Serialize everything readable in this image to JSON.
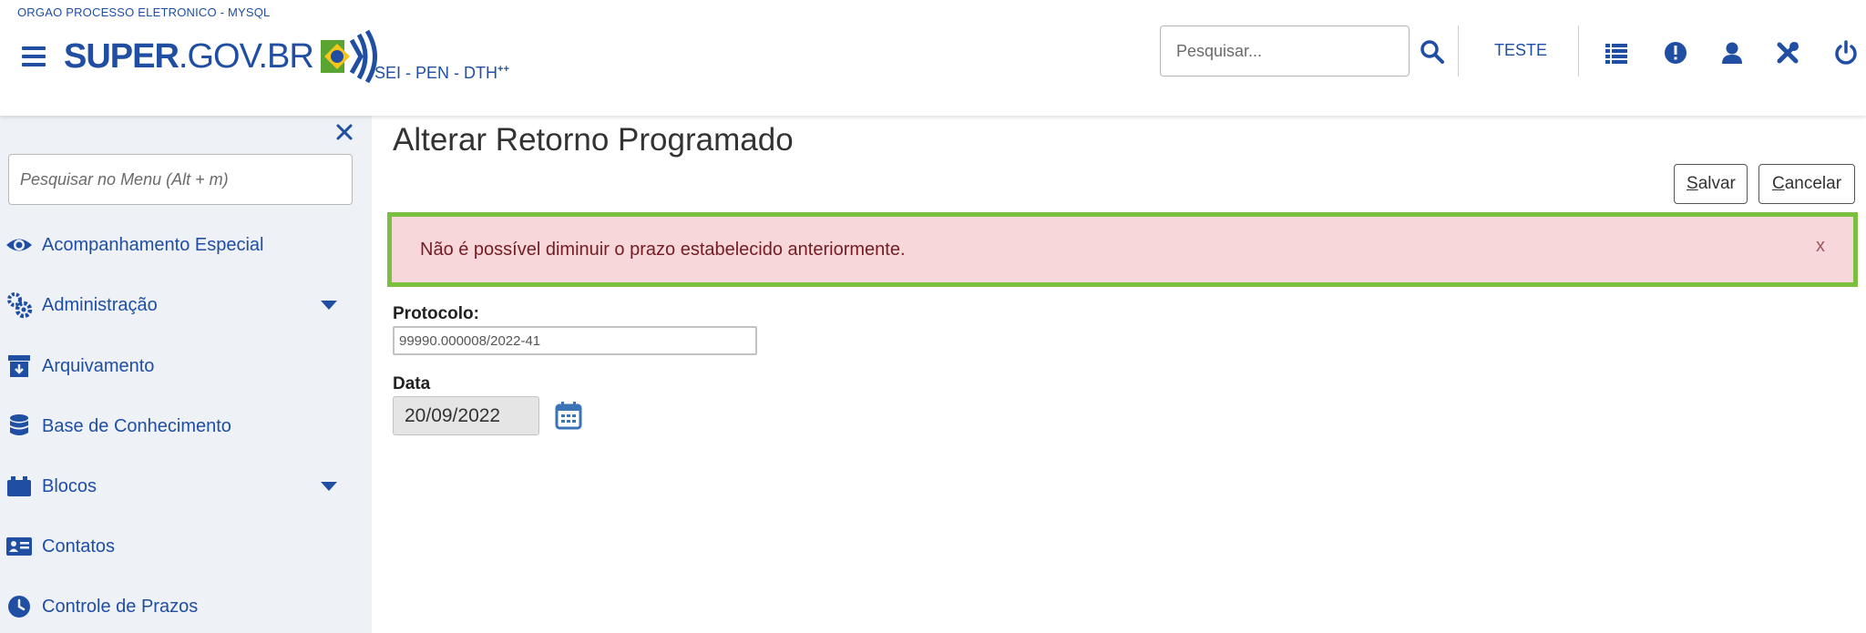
{
  "header": {
    "org_name": "ORGAO PROCESSO ELETRONICO - MYSQL",
    "logo_bold": "SUPER",
    "logo_thin": ".GOV.BR",
    "subtitle": "SEI - PEN - DTH",
    "subtitle_sup": "++",
    "search_placeholder": "Pesquisar...",
    "unit": "TESTE",
    "icons": [
      "menu-icon",
      "search-icon",
      "list-icon",
      "info-icon",
      "user-icon",
      "tools-icon",
      "power-icon"
    ]
  },
  "sidebar": {
    "menu_search_placeholder": "Pesquisar no Menu (Alt + m)",
    "items": [
      {
        "label": "Acompanhamento Especial",
        "icon": "eye-icon",
        "expandable": false
      },
      {
        "label": "Administração",
        "icon": "gears-icon",
        "expandable": true
      },
      {
        "label": "Arquivamento",
        "icon": "archive-icon",
        "expandable": false
      },
      {
        "label": "Base de Conhecimento",
        "icon": "database-icon",
        "expandable": false
      },
      {
        "label": "Blocos",
        "icon": "blocks-icon",
        "expandable": true
      },
      {
        "label": "Contatos",
        "icon": "contact-card-icon",
        "expandable": false
      },
      {
        "label": "Controle de Prazos",
        "icon": "clock-icon",
        "expandable": false
      }
    ]
  },
  "main": {
    "title": "Alterar Retorno Programado",
    "save_first": "S",
    "save_rest": "alvar",
    "cancel_first": "C",
    "cancel_rest": "ancelar",
    "alert": {
      "message": "Não é possível diminuir o prazo estabelecido anteriormente.",
      "close": "x"
    },
    "protocolo_label": "Protocolo:",
    "protocolo_value": "99990.000008/2022-41",
    "data_label": "Data",
    "data_value": "20/09/2022"
  },
  "colors": {
    "brand": "#1f4ea3",
    "alert_bg": "#f8d7da",
    "alert_border": "#7bbf3f",
    "sidebar_bg": "#eef1f6"
  }
}
